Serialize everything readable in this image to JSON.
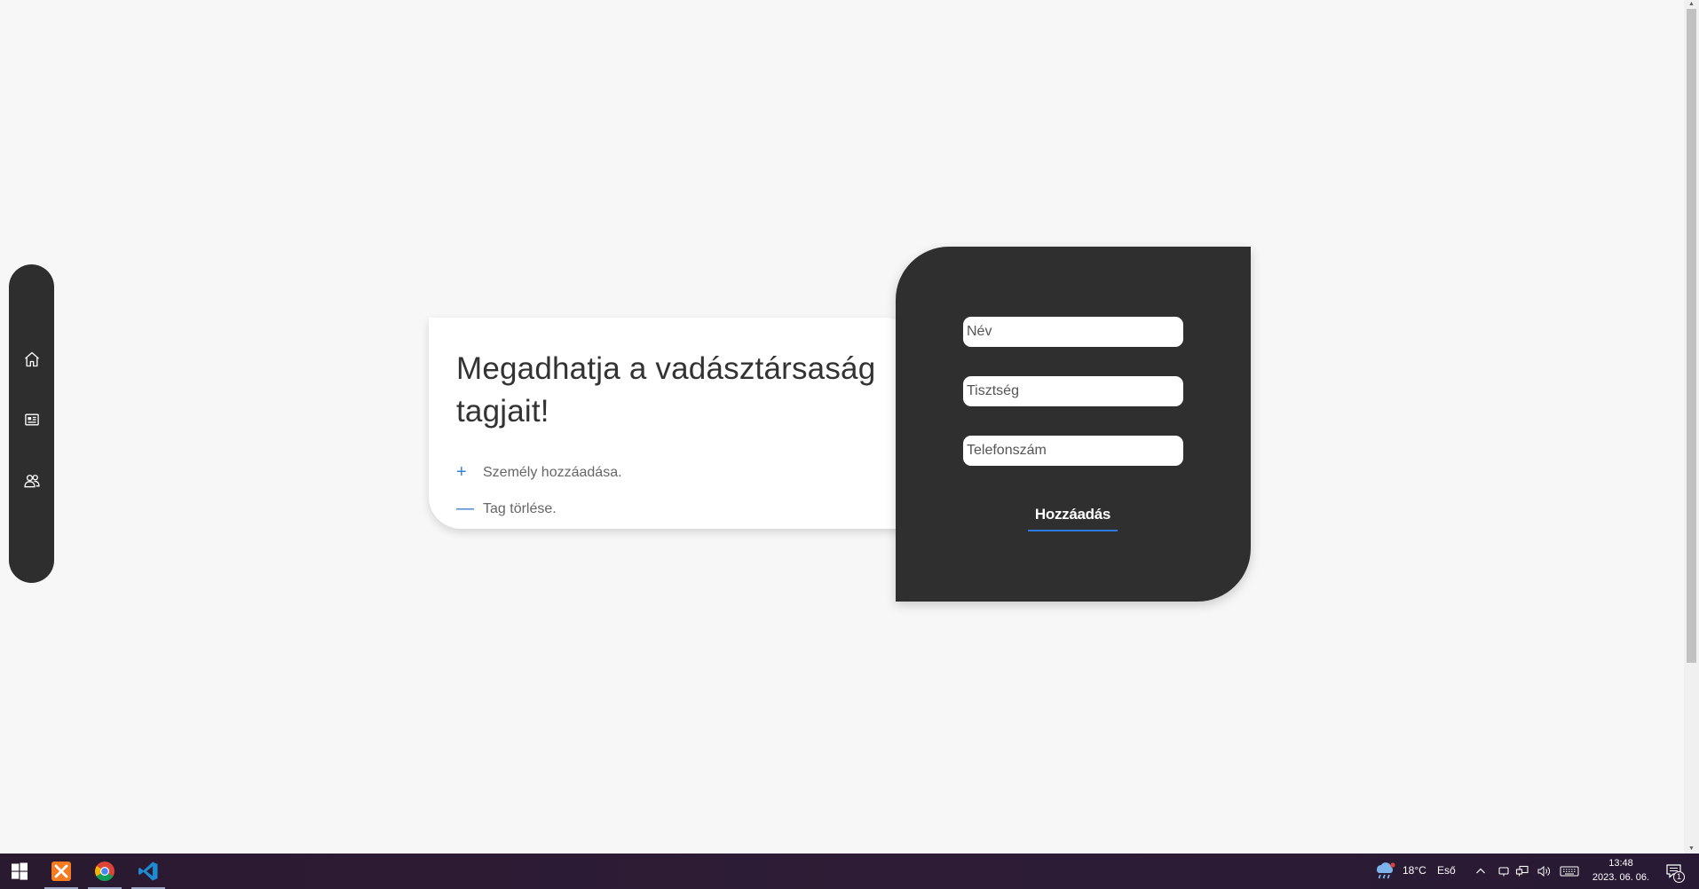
{
  "sidebar": {
    "items": [
      {
        "icon": "home-icon"
      },
      {
        "icon": "news-icon"
      },
      {
        "icon": "members-icon"
      }
    ]
  },
  "info_card": {
    "title": "Megadhatja a vadásztársaság tagjait!",
    "items": [
      {
        "glyph": "+",
        "label": "Személy hozzáadása."
      },
      {
        "glyph": "—",
        "label": "Tag törlése."
      }
    ]
  },
  "form": {
    "name_placeholder": "Név",
    "title_placeholder": "Tisztség",
    "phone_placeholder": "Telefonszám",
    "submit_label": "Hozzáadás"
  },
  "taskbar": {
    "apps": [
      "windows-start-icon",
      "xampp-icon",
      "chrome-icon",
      "vscode-icon"
    ],
    "weather_temp": "18°C",
    "weather_desc": "Eső",
    "time": "13:48",
    "date": "2023. 06. 06.",
    "notification_count": "1"
  },
  "colors": {
    "background": "#f7f7f7",
    "dark_panel": "#2f2f2f",
    "accent": "#3b82d6",
    "taskbar": "#2c1b34"
  }
}
